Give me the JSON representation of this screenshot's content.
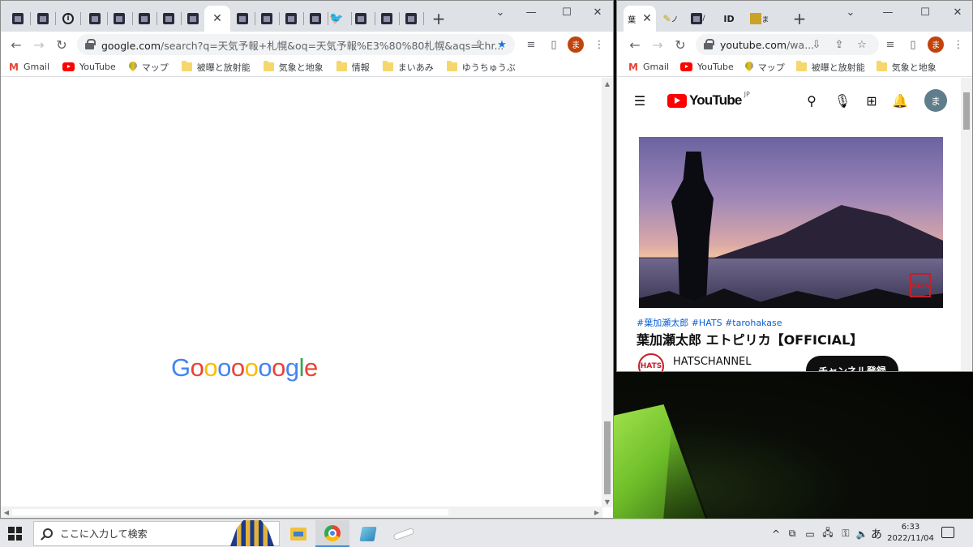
{
  "left_window": {
    "tabs": [
      {
        "icon": "site-favicon"
      },
      {
        "icon": "site-favicon"
      },
      {
        "icon": "info-favicon"
      },
      {
        "icon": "site-favicon"
      },
      {
        "icon": "site-favicon"
      },
      {
        "icon": "site-favicon"
      },
      {
        "icon": "site-favicon"
      },
      {
        "icon": "site-favicon"
      },
      {
        "icon": "close-icon",
        "active": true
      },
      {
        "icon": "site-favicon"
      },
      {
        "icon": "site-favicon"
      },
      {
        "icon": "site-favicon"
      },
      {
        "icon": "site-favicon"
      },
      {
        "icon": "twitter-favicon"
      },
      {
        "icon": "site-favicon"
      },
      {
        "icon": "site-favicon"
      },
      {
        "icon": "site-favicon"
      }
    ],
    "new_tab": "+",
    "url_main": "google.com",
    "url_rest": "/search?q=天気予報+札幌&oq=天気予報%E3%80%80札幌&aqs=chr...",
    "avatar": "ま",
    "logo_letters": [
      "G",
      "o",
      "o",
      "o",
      "o",
      "o",
      "o",
      "o",
      "g",
      "l",
      "e"
    ]
  },
  "bookmarks": [
    {
      "label": "Gmail",
      "icon": "gmail-icon"
    },
    {
      "label": "YouTube",
      "icon": "youtube-icon"
    },
    {
      "label": "マップ",
      "icon": "maps-icon"
    },
    {
      "label": "被曝と放射能",
      "icon": "folder-icon"
    },
    {
      "label": "気象と地象",
      "icon": "folder-icon"
    },
    {
      "label": "情報",
      "icon": "folder-icon"
    },
    {
      "label": "まいあみ",
      "icon": "folder-icon"
    },
    {
      "label": "ゆうちゅうぶ",
      "icon": "folder-icon"
    }
  ],
  "right_window": {
    "tabs": [
      "葉",
      "ノ",
      "/",
      "ID",
      "ま"
    ],
    "new_tab": "+",
    "url_main": "youtube.com",
    "url_rest": "/wa...",
    "avatar": "ま",
    "bookmarks": [
      {
        "label": "Gmail"
      },
      {
        "label": "YouTube"
      },
      {
        "label": "マップ"
      },
      {
        "label": "被曝と放射能"
      },
      {
        "label": "気象と地象"
      }
    ],
    "youtube": {
      "logo": "YouTube",
      "region": "JP",
      "avatar": "ま",
      "hashtags": "#葉加瀬太郎 #HATS #tarohakase",
      "video_title": "葉加瀬太郎 エトピリカ【OFFICIAL】",
      "channel_name": "HATSCHANNEL",
      "channel_logo": "HATS",
      "subscribe": "チャンネル登録",
      "thumb_seal": "HATS"
    }
  },
  "taskbar": {
    "search_placeholder": "ここに入力して検索",
    "time": "6:33",
    "date": "2022/11/04",
    "ime": "あ"
  }
}
